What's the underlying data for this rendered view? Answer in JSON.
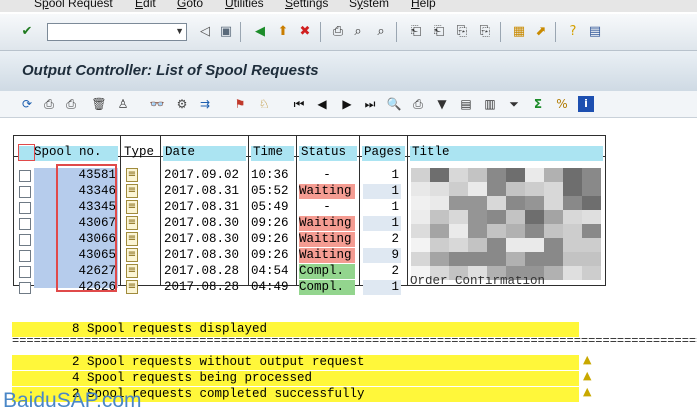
{
  "menu": {
    "items": [
      {
        "pre": "S",
        "u": "p",
        "post": "ool Request"
      },
      {
        "pre": "",
        "u": "E",
        "post": "dit"
      },
      {
        "pre": "",
        "u": "G",
        "post": "oto"
      },
      {
        "pre": "",
        "u": "U",
        "post": "tilities"
      },
      {
        "pre": "",
        "u": "S",
        "post": "ettings"
      },
      {
        "pre": "S",
        "u": "y",
        "post": "stem"
      },
      {
        "pre": "",
        "u": "H",
        "post": "elp"
      }
    ]
  },
  "toolbar": {
    "command_value": "",
    "icons": [
      "enter-icon",
      "save-icon",
      "back-icon",
      "exit-icon",
      "cancel-icon",
      "print-icon",
      "find-icon",
      "find-next-icon",
      "first-page-icon",
      "prev-page-icon",
      "next-page-icon",
      "last-page-icon",
      "create-session-icon",
      "shortcut-icon",
      "help-icon",
      "layout-icon"
    ]
  },
  "page": {
    "title": "Output Controller: List of Spool Requests"
  },
  "app_toolbar": {
    "icons": [
      "refresh-icon",
      "print-icon",
      "print-changed-icon",
      "delete-icon",
      "user-icon",
      "display-icon",
      "settings-icon",
      "forward-icon",
      "attributes-icon",
      "output-requests-icon",
      "first-icon",
      "previous-icon",
      "next-icon",
      "last-icon",
      "details-icon",
      "tsp-icon",
      "filter-icon",
      "sort-icon",
      "change-layout-icon",
      "funnel-icon",
      "sum-icon",
      "export-icon",
      "info-icon"
    ]
  },
  "list": {
    "columns": [
      "Spool no.",
      "Type",
      "Date",
      "Time",
      "Status",
      "Pages",
      "Title"
    ],
    "rows": [
      {
        "spool": "43581",
        "date": "2017.09.02",
        "time": "10:36",
        "status": "-",
        "pages": "1"
      },
      {
        "spool": "43346",
        "date": "2017.08.31",
        "time": "05:52",
        "status": "Waiting",
        "pages": "1"
      },
      {
        "spool": "43345",
        "date": "2017.08.31",
        "time": "05:49",
        "status": "-",
        "pages": "1"
      },
      {
        "spool": "43067",
        "date": "2017.08.30",
        "time": "09:26",
        "status": "Waiting",
        "pages": "1"
      },
      {
        "spool": "43066",
        "date": "2017.08.30",
        "time": "09:26",
        "status": "Waiting",
        "pages": "2"
      },
      {
        "spool": "43065",
        "date": "2017.08.30",
        "time": "09:26",
        "status": "Waiting",
        "pages": "9"
      },
      {
        "spool": "42627",
        "date": "2017.08.28",
        "time": "04:54",
        "status": "Compl.",
        "pages": "2"
      },
      {
        "spool": "42626",
        "date": "2017.08.28",
        "time": "04:49",
        "status": "Compl.",
        "pages": "1"
      }
    ],
    "last_title_fragment": "Order Confirmation"
  },
  "summary": {
    "line1": "        8 Spool requests displayed",
    "line2": "        2 Spool requests without output request",
    "line3": "        4 Spool requests being processed",
    "line4": "        2 Spool requests completed successfully"
  },
  "watermark": "BaiduSAP.com",
  "colors": {
    "status_waiting": "#f49c92",
    "status_completed": "#93d58e",
    "header_bar": "#abe4f2",
    "summary_bg": "#fff73a",
    "highlight_box": "#e04a4a"
  }
}
